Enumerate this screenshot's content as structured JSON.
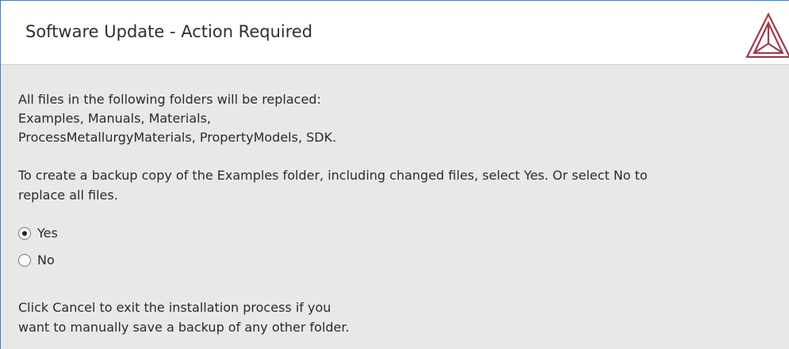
{
  "window": {
    "title": "Software Update - Action Required"
  },
  "logo": {
    "icon": "thermo-calc-triangle-logo",
    "color": "#a2384d"
  },
  "content": {
    "folders_intro": "All files in the following folders will be replaced:",
    "folders_line1": "Examples, Manuals, Materials,",
    "folders_line2": "ProcessMetallurgyMaterials, PropertyModels, SDK.",
    "backup_prompt_line1": "To create a backup copy of the Examples folder, including changed files, select Yes. Or select No to",
    "backup_prompt_line2": "replace all files.",
    "options": [
      {
        "label": "Yes",
        "selected": true
      },
      {
        "label": "No",
        "selected": false
      }
    ],
    "cancel_note_line1": "Click Cancel to exit the installation process if you",
    "cancel_note_line2": "want to manually save a backup of any other folder."
  }
}
